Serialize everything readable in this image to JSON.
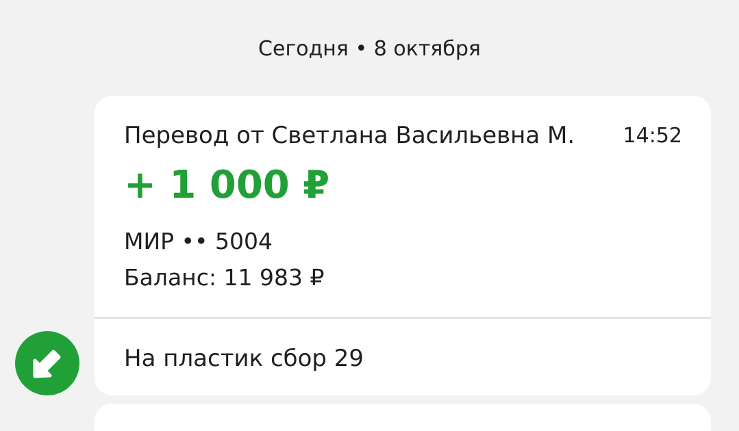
{
  "date_header": "Сегодня • 8 октября",
  "transaction": {
    "title": "Перевод от Светлана Васильевна М.",
    "time": "14:52",
    "amount": "+ 1 000 ₽",
    "card": "МИР •• 5004",
    "balance": "Баланс: 11 983 ₽",
    "message": "На пластик сбор 29"
  },
  "avatar": {
    "icon": "incoming-arrow-icon",
    "color": "#21a038"
  },
  "colors": {
    "accent": "#21a038",
    "background": "#f2f2f2",
    "card": "#ffffff"
  }
}
